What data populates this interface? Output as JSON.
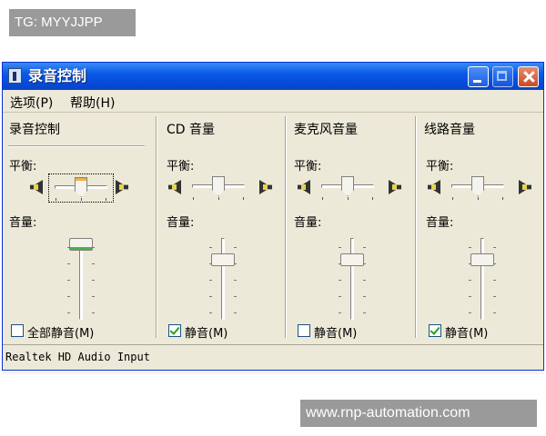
{
  "watermark_top": "TG: MYYJJPP",
  "watermark_bottom": "www.rnp-automation.com",
  "window": {
    "title": "录音控制",
    "menu": [
      "选项(P)",
      "帮助(H)"
    ],
    "balance_label": "平衡:",
    "volume_label": "音量:",
    "columns": [
      {
        "title": "录音控制",
        "mute_label": "全部静音(M)",
        "mute_checked": false,
        "balance": 0.5,
        "volume": 1.0
      },
      {
        "title": "CD 音量",
        "mute_label": "静音(M)",
        "mute_checked": true,
        "balance": 0.5,
        "volume": 0.78
      },
      {
        "title": "麦克风音量",
        "mute_label": "静音(M)",
        "mute_checked": false,
        "balance": 0.5,
        "volume": 0.78
      },
      {
        "title": "线路音量",
        "mute_label": "静音(M)",
        "mute_checked": true,
        "balance": 0.5,
        "volume": 0.78
      }
    ],
    "status": "Realtek HD Audio Input"
  },
  "icons": [
    "window-icon",
    "minimize-icon",
    "maximize-icon",
    "close-icon",
    "speaker-left-icon",
    "speaker-right-icon",
    "checkbox-check-icon"
  ],
  "colors": {
    "titlebar": "#0a5ae6",
    "window_bg": "#ece9d8",
    "close_button": "#c94a26",
    "check": "#21a121"
  }
}
